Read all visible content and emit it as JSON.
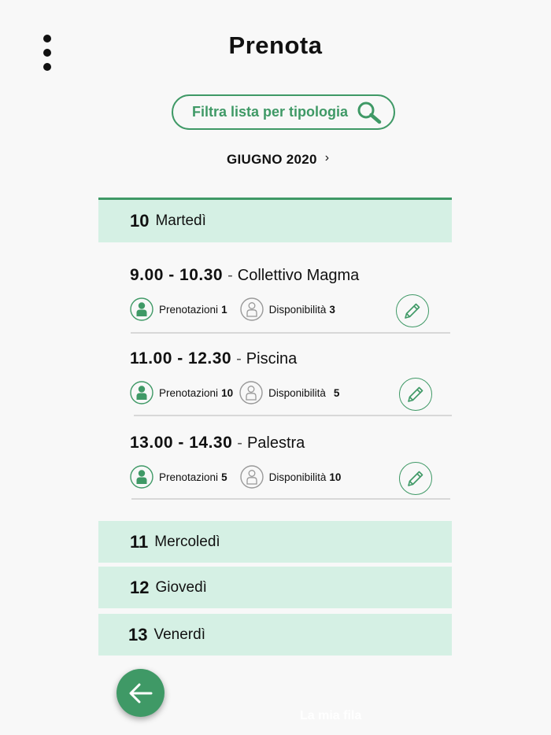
{
  "header": {
    "title": "Prenota"
  },
  "filter": {
    "label": "Filtra lista per tipologia"
  },
  "month": {
    "label": "GIUGNO 2020",
    "chevron": "›"
  },
  "days": [
    {
      "number": "10",
      "name": "Martedì"
    },
    {
      "number": "11",
      "name": "Mercoledì"
    },
    {
      "number": "12",
      "name": "Giovedì"
    },
    {
      "number": "13",
      "name": "Venerdì"
    }
  ],
  "slots": [
    {
      "time": "9.00 - 10.30",
      "dash": "-",
      "name": "Collettivo Magma",
      "bookings_label": "Prenotazioni",
      "bookings": "1",
      "availability_label": "Disponibilità",
      "availability": "3"
    },
    {
      "time": "11.00 - 12.30",
      "dash": "-",
      "name": "Piscina",
      "bookings_label": "Prenotazioni",
      "bookings": "10",
      "availability_label": "Disponibilità",
      "availability": "5"
    },
    {
      "time": "13.00 - 14.30",
      "dash": "-",
      "name": "Palestra",
      "bookings_label": "Prenotazioni",
      "bookings": "5",
      "availability_label": "Disponibilità",
      "availability": "10"
    }
  ],
  "footer": {
    "link": "La mia fila"
  },
  "colors": {
    "accent": "#3f9966",
    "day_bg": "#d5f0e4",
    "page_bg": "#f8f8f8"
  },
  "icons": {
    "menu": "more-vertical-icon",
    "search": "search-icon",
    "chevron": "chevron-right-icon",
    "booked": "person-filled-icon",
    "available": "person-outline-icon",
    "edit": "pencil-icon",
    "back": "arrow-left-icon"
  }
}
